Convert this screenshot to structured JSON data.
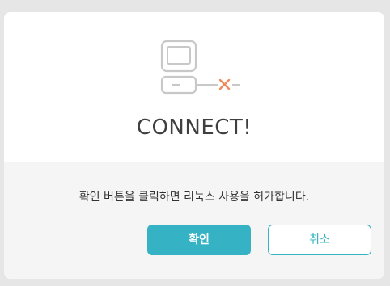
{
  "dialog": {
    "title": "CONNECT!",
    "message": "확인 버튼을 클릭하면 리눅스 사용을 허가합니다.",
    "confirm_label": "확인",
    "cancel_label": "취소"
  },
  "icon": {
    "name": "disconnected-computer-icon"
  },
  "colors": {
    "accent": "#36b2c5",
    "disconnect_x": "#f08a5d",
    "icon_stroke": "#c8c8c8",
    "background": "#e6e6e6",
    "footer_background": "#f5f5f5"
  }
}
